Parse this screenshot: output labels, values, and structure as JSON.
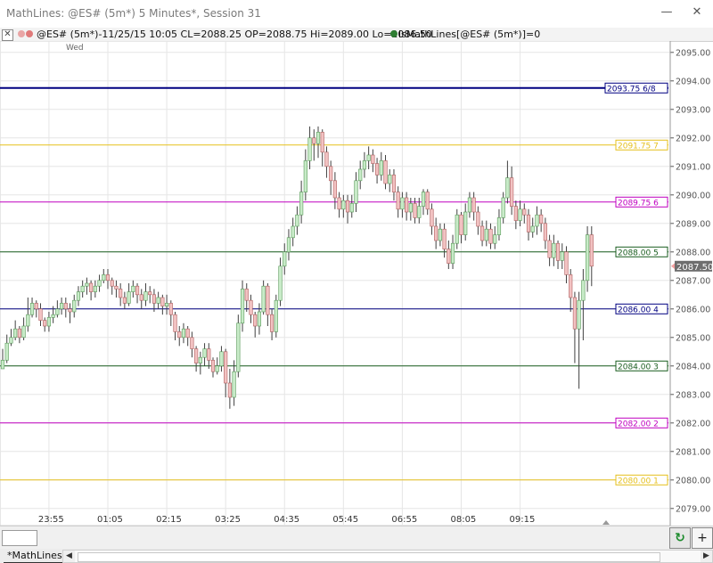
{
  "window": {
    "title": "MathLines: @ES# (5m*) 5 Minutes*, Session 31",
    "minimize_glyph": "—",
    "close_glyph": "✕"
  },
  "infobar": {
    "close_glyph": "✕",
    "symbol_info": "@ES# (5m*)-11/25/15 10:05 CL=2088.25 OP=2088.75 Hi=2089.00 Lo=2086.50",
    "indicator_info": "lsMathLines[@ES# (5m*)]=0",
    "dot_colors": [
      "#e9a5a5",
      "#e07a7a",
      "#2e7d32"
    ]
  },
  "chart": {
    "day_label": "Wed",
    "current_price_label": "2087.50",
    "colors": {
      "up_fill": "#c8ebc8",
      "down_fill": "#f2c2c2",
      "wick": "#404040",
      "grid": "#e6e6e6"
    }
  },
  "chart_data": {
    "type": "candlestick",
    "y_ticks": [
      "2079.00",
      "2080.00",
      "2081.00",
      "2082.00",
      "2083.00",
      "2084.00",
      "2085.00",
      "2086.00",
      "2087.00",
      "2088.00",
      "2089.00",
      "2090.00",
      "2091.00",
      "2092.00",
      "2093.00",
      "2094.00",
      "2095.00"
    ],
    "ylim": [
      2078.4,
      2095.4
    ],
    "x_ticks": [
      "23:55",
      "01:05",
      "02:15",
      "03:25",
      "04:35",
      "05:45",
      "06:55",
      "08:05",
      "09:15"
    ],
    "x_tick_index": [
      11,
      25,
      39,
      53,
      67,
      81,
      95,
      109,
      123
    ],
    "math_lines": [
      {
        "label": "2093.75 6/8",
        "price": 2093.75,
        "color": "#000080",
        "width": 2
      },
      {
        "label": "2091.75 7",
        "price": 2091.75,
        "color": "#e5c01c",
        "width": 1
      },
      {
        "label": "2089.75 6",
        "price": 2089.75,
        "color": "#c000c0",
        "width": 1
      },
      {
        "label": "2088.00 5",
        "price": 2088.0,
        "color": "#1b5e20",
        "width": 1
      },
      {
        "label": "2086.00 4",
        "price": 2086.0,
        "color": "#000080",
        "width": 1
      },
      {
        "label": "2084.00 3",
        "price": 2084.0,
        "color": "#1b5e20",
        "width": 1
      },
      {
        "label": "2082.00 2",
        "price": 2082.0,
        "color": "#c000c0",
        "width": 1
      },
      {
        "label": "2080.00 1",
        "price": 2080.0,
        "color": "#e5c01c",
        "width": 1
      }
    ],
    "closes": [
      2084.2,
      2084.8,
      2085.0,
      2085.3,
      2085.0,
      2085.4,
      2085.8,
      2086.2,
      2086.0,
      2085.6,
      2085.4,
      2085.7,
      2085.8,
      2086.0,
      2086.2,
      2086.0,
      2085.9,
      2086.3,
      2086.6,
      2086.8,
      2086.9,
      2086.6,
      2086.8,
      2087.0,
      2087.2,
      2087.0,
      2086.8,
      2086.7,
      2086.4,
      2086.2,
      2086.6,
      2086.8,
      2086.5,
      2086.3,
      2086.6,
      2086.5,
      2086.2,
      2086.4,
      2086.1,
      2086.2,
      2085.8,
      2085.2,
      2085.0,
      2085.3,
      2085.0,
      2084.6,
      2084.1,
      2084.3,
      2084.6,
      2084.2,
      2083.8,
      2084.0,
      2084.5,
      2083.4,
      2082.9,
      2083.8,
      2085.5,
      2086.7,
      2086.3,
      2085.8,
      2085.4,
      2085.9,
      2086.8,
      2085.8,
      2085.2,
      2086.3,
      2087.5,
      2088.0,
      2088.5,
      2088.9,
      2089.3,
      2090.1,
      2091.2,
      2092.0,
      2091.8,
      2092.2,
      2091.5,
      2091.0,
      2090.5,
      2089.9,
      2089.5,
      2089.8,
      2089.4,
      2089.7,
      2090.5,
      2090.9,
      2091.2,
      2091.4,
      2091.1,
      2090.7,
      2091.2,
      2090.4,
      2090.7,
      2090.1,
      2089.5,
      2089.9,
      2089.4,
      2089.7,
      2089.2,
      2089.6,
      2090.1,
      2089.5,
      2088.9,
      2088.4,
      2088.8,
      2088.1,
      2087.6,
      2088.3,
      2089.3,
      2088.6,
      2089.4,
      2089.9,
      2089.4,
      2088.9,
      2088.4,
      2088.8,
      2088.3,
      2088.6,
      2089.2,
      2089.9,
      2090.6,
      2089.6,
      2089.1,
      2089.5,
      2089.3,
      2088.7,
      2088.9,
      2089.3,
      2089.0,
      2088.4,
      2087.8,
      2088.3,
      2087.7,
      2088.0,
      2087.2,
      2086.4,
      2085.3,
      2086.3,
      2087.0,
      2088.6,
      2087.5
    ],
    "candle_extents": [
      {
        "h": 2084.6,
        "l": 2083.9
      },
      {
        "h": 2085.1,
        "l": 2084.1
      },
      {
        "h": 2085.3,
        "l": 2084.7
      },
      {
        "h": 2085.6,
        "l": 2084.9
      },
      {
        "h": 2085.4,
        "l": 2084.8
      },
      {
        "h": 2085.7,
        "l": 2084.9
      },
      {
        "h": 2086.4,
        "l": 2085.2
      },
      {
        "h": 2086.4,
        "l": 2085.7
      },
      {
        "h": 2086.3,
        "l": 2085.7
      },
      {
        "h": 2086.2,
        "l": 2085.4
      },
      {
        "h": 2085.7,
        "l": 2085.2
      },
      {
        "h": 2085.9,
        "l": 2085.2
      },
      {
        "h": 2086.1,
        "l": 2085.5
      },
      {
        "h": 2086.3,
        "l": 2085.7
      },
      {
        "h": 2086.4,
        "l": 2085.8
      },
      {
        "h": 2086.4,
        "l": 2085.7
      },
      {
        "h": 2086.2,
        "l": 2085.5
      },
      {
        "h": 2086.5,
        "l": 2085.7
      },
      {
        "h": 2086.8,
        "l": 2086.1
      },
      {
        "h": 2087.0,
        "l": 2086.4
      },
      {
        "h": 2087.1,
        "l": 2086.5
      },
      {
        "h": 2087.0,
        "l": 2086.3
      },
      {
        "h": 2087.0,
        "l": 2086.4
      },
      {
        "h": 2087.2,
        "l": 2086.6
      },
      {
        "h": 2087.4,
        "l": 2086.9
      },
      {
        "h": 2087.4,
        "l": 2086.7
      },
      {
        "h": 2087.1,
        "l": 2086.5
      },
      {
        "h": 2087.0,
        "l": 2086.4
      },
      {
        "h": 2086.9,
        "l": 2086.1
      },
      {
        "h": 2086.6,
        "l": 2086.0
      },
      {
        "h": 2086.9,
        "l": 2086.1
      },
      {
        "h": 2087.0,
        "l": 2086.4
      },
      {
        "h": 2086.9,
        "l": 2086.2
      },
      {
        "h": 2086.7,
        "l": 2086.0
      },
      {
        "h": 2086.9,
        "l": 2086.1
      },
      {
        "h": 2086.8,
        "l": 2086.2
      },
      {
        "h": 2086.7,
        "l": 2085.9
      },
      {
        "h": 2086.6,
        "l": 2086.0
      },
      {
        "h": 2086.5,
        "l": 2085.8
      },
      {
        "h": 2086.5,
        "l": 2085.8
      },
      {
        "h": 2086.3,
        "l": 2085.4
      },
      {
        "h": 2085.9,
        "l": 2084.9
      },
      {
        "h": 2085.4,
        "l": 2084.7
      },
      {
        "h": 2085.5,
        "l": 2084.8
      },
      {
        "h": 2085.4,
        "l": 2084.7
      },
      {
        "h": 2085.2,
        "l": 2084.3
      },
      {
        "h": 2084.7,
        "l": 2083.8
      },
      {
        "h": 2084.5,
        "l": 2083.7
      },
      {
        "h": 2084.8,
        "l": 2084.0
      },
      {
        "h": 2084.8,
        "l": 2083.9
      },
      {
        "h": 2084.3,
        "l": 2083.6
      },
      {
        "h": 2084.3,
        "l": 2083.7
      },
      {
        "h": 2084.7,
        "l": 2083.8
      },
      {
        "h": 2084.6,
        "l": 2082.9
      },
      {
        "h": 2083.9,
        "l": 2082.5
      },
      {
        "h": 2084.2,
        "l": 2082.6
      },
      {
        "h": 2085.8,
        "l": 2083.6
      },
      {
        "h": 2087.0,
        "l": 2085.2
      },
      {
        "h": 2086.9,
        "l": 2085.9
      },
      {
        "h": 2086.5,
        "l": 2085.5
      },
      {
        "h": 2085.9,
        "l": 2085.0
      },
      {
        "h": 2086.2,
        "l": 2085.1
      },
      {
        "h": 2087.0,
        "l": 2085.8
      },
      {
        "h": 2086.9,
        "l": 2085.4
      },
      {
        "h": 2086.0,
        "l": 2084.9
      },
      {
        "h": 2086.5,
        "l": 2085.0
      },
      {
        "h": 2087.8,
        "l": 2086.1
      },
      {
        "h": 2088.3,
        "l": 2087.2
      },
      {
        "h": 2088.8,
        "l": 2087.7
      },
      {
        "h": 2089.2,
        "l": 2088.2
      },
      {
        "h": 2089.6,
        "l": 2088.6
      },
      {
        "h": 2090.5,
        "l": 2089.0
      },
      {
        "h": 2091.6,
        "l": 2089.8
      },
      {
        "h": 2092.4,
        "l": 2090.9
      },
      {
        "h": 2092.3,
        "l": 2091.2
      },
      {
        "h": 2092.4,
        "l": 2091.3
      },
      {
        "h": 2092.3,
        "l": 2091.0
      },
      {
        "h": 2091.7,
        "l": 2090.6
      },
      {
        "h": 2091.2,
        "l": 2090.0
      },
      {
        "h": 2090.8,
        "l": 2089.5
      },
      {
        "h": 2090.1,
        "l": 2089.2
      },
      {
        "h": 2090.0,
        "l": 2089.2
      },
      {
        "h": 2090.0,
        "l": 2089.0
      },
      {
        "h": 2090.0,
        "l": 2089.2
      },
      {
        "h": 2090.8,
        "l": 2089.4
      },
      {
        "h": 2091.2,
        "l": 2090.2
      },
      {
        "h": 2091.5,
        "l": 2090.6
      },
      {
        "h": 2091.7,
        "l": 2090.9
      },
      {
        "h": 2091.6,
        "l": 2090.8
      },
      {
        "h": 2091.3,
        "l": 2090.4
      },
      {
        "h": 2091.5,
        "l": 2090.5
      },
      {
        "h": 2091.4,
        "l": 2090.2
      },
      {
        "h": 2090.9,
        "l": 2090.1
      },
      {
        "h": 2090.9,
        "l": 2089.8
      },
      {
        "h": 2090.3,
        "l": 2089.2
      },
      {
        "h": 2090.1,
        "l": 2089.2
      },
      {
        "h": 2090.1,
        "l": 2089.1
      },
      {
        "h": 2089.9,
        "l": 2089.1
      },
      {
        "h": 2089.9,
        "l": 2089.0
      },
      {
        "h": 2089.9,
        "l": 2089.0
      },
      {
        "h": 2090.2,
        "l": 2089.3
      },
      {
        "h": 2090.2,
        "l": 2089.3
      },
      {
        "h": 2089.7,
        "l": 2088.6
      },
      {
        "h": 2089.2,
        "l": 2088.1
      },
      {
        "h": 2089.0,
        "l": 2088.2
      },
      {
        "h": 2089.0,
        "l": 2087.8
      },
      {
        "h": 2088.4,
        "l": 2087.4
      },
      {
        "h": 2088.6,
        "l": 2087.4
      },
      {
        "h": 2089.5,
        "l": 2088.1
      },
      {
        "h": 2089.4,
        "l": 2088.3
      },
      {
        "h": 2089.7,
        "l": 2088.4
      },
      {
        "h": 2090.1,
        "l": 2089.2
      },
      {
        "h": 2090.1,
        "l": 2089.1
      },
      {
        "h": 2089.6,
        "l": 2088.6
      },
      {
        "h": 2089.1,
        "l": 2088.2
      },
      {
        "h": 2089.1,
        "l": 2088.2
      },
      {
        "h": 2089.0,
        "l": 2088.1
      },
      {
        "h": 2088.9,
        "l": 2088.1
      },
      {
        "h": 2089.5,
        "l": 2088.4
      },
      {
        "h": 2090.1,
        "l": 2089.0
      },
      {
        "h": 2091.2,
        "l": 2089.7
      },
      {
        "h": 2091.0,
        "l": 2089.3
      },
      {
        "h": 2089.8,
        "l": 2088.8
      },
      {
        "h": 2089.8,
        "l": 2088.9
      },
      {
        "h": 2089.7,
        "l": 2089.0
      },
      {
        "h": 2089.5,
        "l": 2088.4
      },
      {
        "h": 2089.2,
        "l": 2088.5
      },
      {
        "h": 2089.6,
        "l": 2088.6
      },
      {
        "h": 2089.5,
        "l": 2088.7
      },
      {
        "h": 2089.2,
        "l": 2088.1
      },
      {
        "h": 2088.6,
        "l": 2087.5
      },
      {
        "h": 2088.6,
        "l": 2087.5
      },
      {
        "h": 2088.4,
        "l": 2087.4
      },
      {
        "h": 2088.3,
        "l": 2087.4
      },
      {
        "h": 2088.2,
        "l": 2086.9
      },
      {
        "h": 2087.4,
        "l": 2085.9
      },
      {
        "h": 2086.6,
        "l": 2084.1
      },
      {
        "h": 2086.6,
        "l": 2083.2
      },
      {
        "h": 2087.4,
        "l": 2084.9
      },
      {
        "h": 2088.9,
        "l": 2086.6
      },
      {
        "h": 2088.9,
        "l": 2086.8
      }
    ]
  },
  "bottom": {
    "refresh_glyph": "↻",
    "plus_glyph": "+",
    "tab_label": "*MathLines",
    "scroll_left": "◀",
    "scroll_right": "▶"
  }
}
